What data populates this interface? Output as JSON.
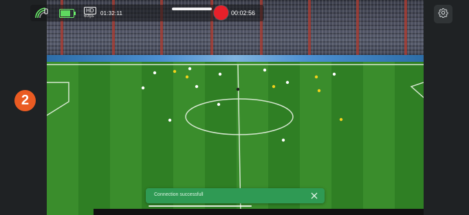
{
  "status_bar": {
    "quality_badge": "HD",
    "frame_rate": "60fps",
    "stream_time": "01:32:11",
    "record_time": "00:02:56",
    "battery_level": 0.75,
    "icons": [
      "signal-icon",
      "battery-icon",
      "record-icon"
    ]
  },
  "settings": {
    "icon": "gear-icon"
  },
  "step_badge": {
    "number": "2"
  },
  "toast": {
    "message": "Connection successfull",
    "close_icon": "close-icon"
  },
  "colors": {
    "record": "#e8202a",
    "toast_bg": "#2f9a54",
    "step_badge": "#ea5b22",
    "panel_bg": "#1f2224",
    "pitch_green": "#3a8d2c"
  }
}
